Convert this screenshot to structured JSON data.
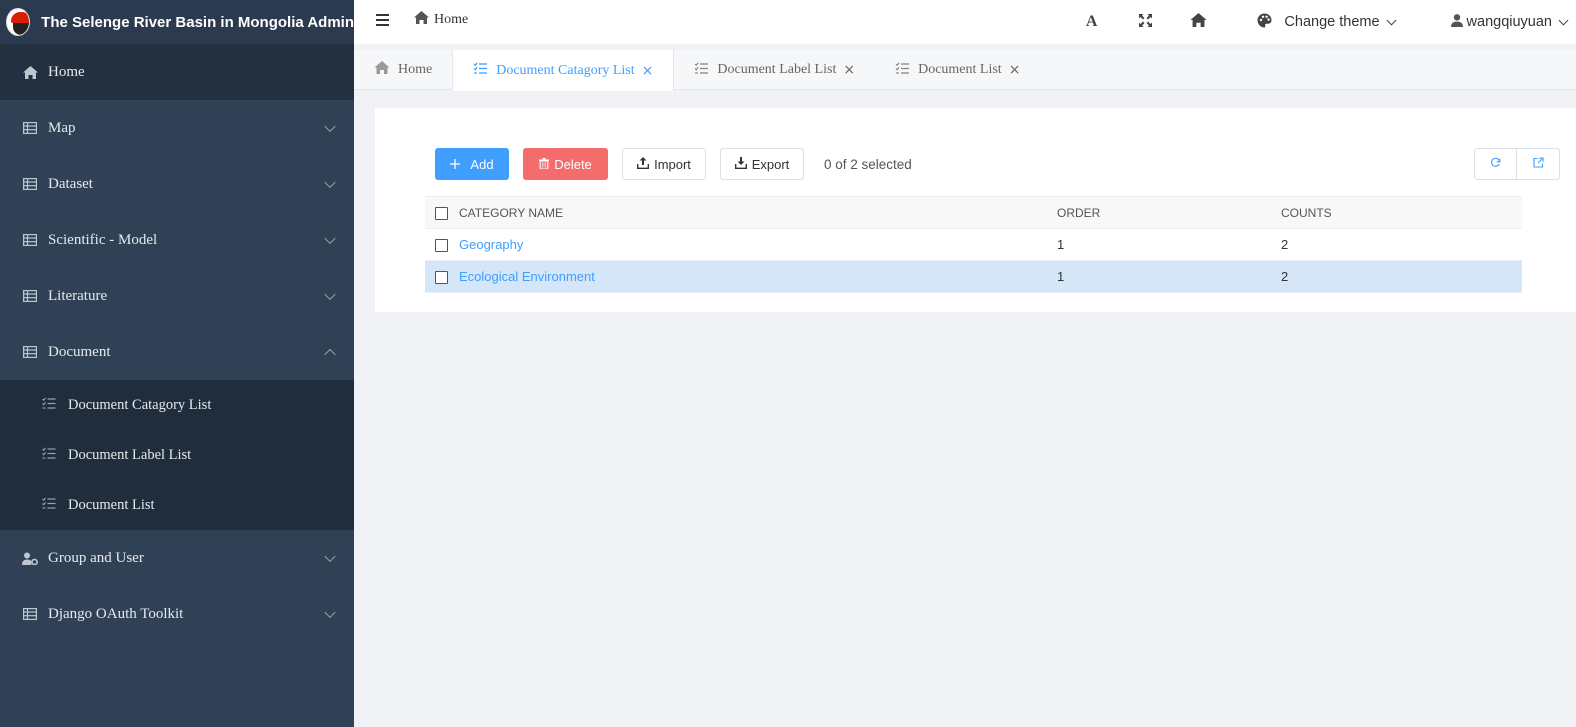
{
  "app": {
    "title": "The Selenge River Basin in Mongolia Admin"
  },
  "sidebar": {
    "items": [
      {
        "label": "Home",
        "icon": "home-icon",
        "active": true
      },
      {
        "label": "Map",
        "icon": "table-icon"
      },
      {
        "label": "Dataset",
        "icon": "table-icon"
      },
      {
        "label": "Scientific - Model",
        "icon": "table-icon"
      },
      {
        "label": "Literature",
        "icon": "table-icon"
      },
      {
        "label": "Document",
        "icon": "table-icon",
        "expanded": true
      },
      {
        "label": "Group and User",
        "icon": "user-cog-icon"
      },
      {
        "label": "Django OAuth Toolkit",
        "icon": "table-icon"
      }
    ],
    "document_sub": [
      {
        "label": "Document Catagory List",
        "icon": "list-check-icon"
      },
      {
        "label": "Document Label List",
        "icon": "list-check-icon"
      },
      {
        "label": "Document List",
        "icon": "list-check-icon"
      }
    ]
  },
  "header": {
    "breadcrumb": "Home",
    "font_icon_label": "A",
    "theme_label": "Change theme",
    "username": "wangqiuyuan"
  },
  "tabs": [
    {
      "label": "Home",
      "icon": "home-icon",
      "active": false,
      "closable": false
    },
    {
      "label": "Document Catagory List",
      "icon": "list-check-icon",
      "active": true,
      "closable": true
    },
    {
      "label": "Document Label List",
      "icon": "list-check-icon",
      "active": false,
      "closable": true
    },
    {
      "label": "Document List",
      "icon": "list-check-icon",
      "active": false,
      "closable": true
    }
  ],
  "toolbar": {
    "add_label": "Add",
    "delete_label": "Delete",
    "import_label": "Import",
    "export_label": "Export",
    "selection_info": "0 of 2 selected"
  },
  "table": {
    "columns": [
      "CATEGORY NAME",
      "ORDER",
      "COUNTS"
    ],
    "rows": [
      {
        "name": "Geography",
        "order": "1",
        "counts": "2",
        "highlighted": false
      },
      {
        "name": "Ecological Environment",
        "order": "1",
        "counts": "2",
        "highlighted": true
      }
    ]
  },
  "colors": {
    "sidebar_bg": "#304156",
    "accent": "#409eff",
    "danger": "#f56c6c"
  }
}
